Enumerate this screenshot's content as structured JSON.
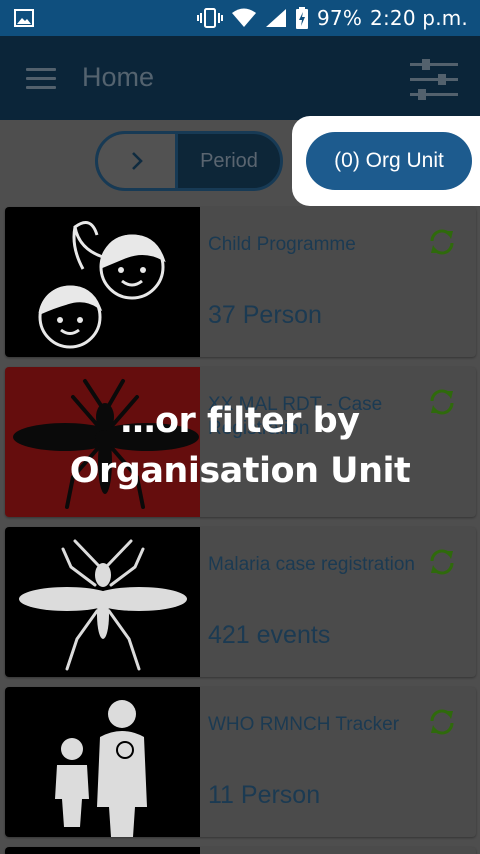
{
  "status_bar": {
    "battery": "97%",
    "time": "2:20 p.m."
  },
  "toolbar": {
    "title": "Home"
  },
  "filters": {
    "period_label": "Period",
    "org_unit_label": "(0) Org Unit"
  },
  "programs": [
    {
      "title": "Child Programme",
      "count": "37 Person"
    },
    {
      "title": "XX MAL RDT - Case Registration",
      "count": ""
    },
    {
      "title": "Malaria case registration",
      "count": "421 events"
    },
    {
      "title": "WHO RMNCH Tracker",
      "count": "11 Person"
    }
  ],
  "overlay": {
    "line1": "…or filter by",
    "line2": "Organisation Unit"
  },
  "colors": {
    "status_bar": "#0f4f7e",
    "toolbar": "#0b2539",
    "org_button": "#1d5b8e",
    "sync_icon": "#2f6a0c"
  }
}
